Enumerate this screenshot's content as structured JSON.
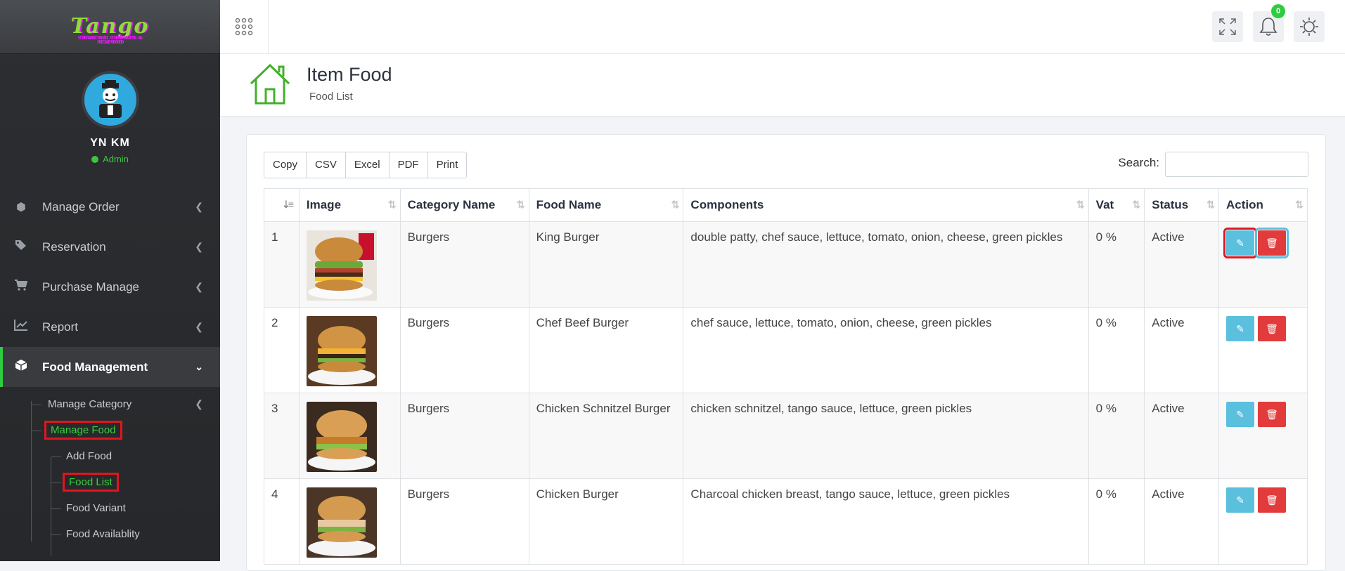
{
  "brand": {
    "logo": "Tango",
    "tagline": "CHARCOAL CHICKEN & SEAFOOD"
  },
  "user": {
    "name": "YN KM",
    "role": "Admin"
  },
  "menu": [
    {
      "label": "Manage Order"
    },
    {
      "label": "Reservation"
    },
    {
      "label": "Purchase Manage"
    },
    {
      "label": "Report"
    },
    {
      "label": "Food Management"
    }
  ],
  "submenu": {
    "manage_category": "Manage Category",
    "manage_food": "Manage Food",
    "add_food": "Add Food",
    "food_list": "Food List",
    "food_variant": "Food Variant",
    "food_availability": "Food Availablity"
  },
  "topbar": {
    "notification_count": "0"
  },
  "page": {
    "title": "Item Food",
    "subtitle": "Food List"
  },
  "toolbar": {
    "buttons": [
      "Copy",
      "CSV",
      "Excel",
      "PDF",
      "Print"
    ],
    "search_label": "Search:",
    "search_value": ""
  },
  "table": {
    "columns": [
      "",
      "Image",
      "Category Name",
      "Food Name",
      "Components",
      "Vat",
      "Status",
      "Action"
    ],
    "rows": [
      {
        "no": "1",
        "category": "Burgers",
        "name": "King Burger",
        "components": "double patty, chef sauce, lettuce, tomato, onion, cheese, green pickles",
        "vat": "0 %",
        "status": "Active"
      },
      {
        "no": "2",
        "category": "Burgers",
        "name": "Chef Beef Burger",
        "components": "chef sauce, lettuce, tomato, onion, cheese, green pickles",
        "vat": "0 %",
        "status": "Active"
      },
      {
        "no": "3",
        "category": "Burgers",
        "name": "Chicken Schnitzel Burger",
        "components": "chicken schnitzel, tango sauce, lettuce, green pickles",
        "vat": "0 %",
        "status": "Active"
      },
      {
        "no": "4",
        "category": "Burgers",
        "name": "Chicken Burger",
        "components": "Charcoal chicken breast, tango sauce, lettuce, green pickles",
        "vat": "0 %",
        "status": "Active"
      }
    ]
  },
  "colors": {
    "accent": "#2ecc40",
    "edit": "#5bc0de",
    "delete": "#e23b3b",
    "highlight": "#e0161e"
  }
}
